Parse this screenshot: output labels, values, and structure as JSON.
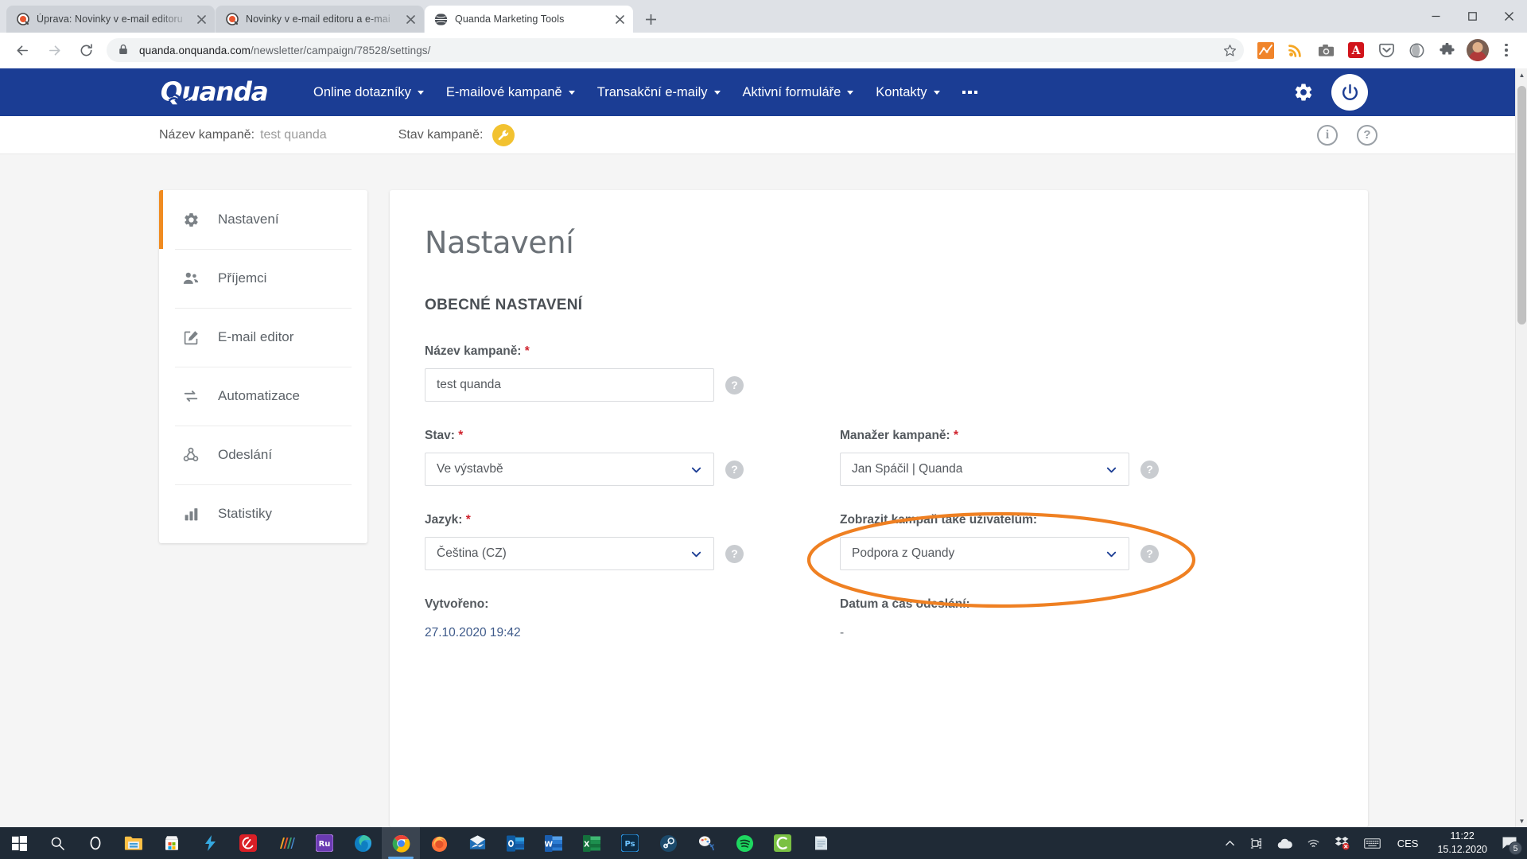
{
  "browser": {
    "tabs": [
      {
        "title": "Úprava: Novinky v e-mail editoru",
        "favicon": "quanda-favicon",
        "active": false
      },
      {
        "title": "Novinky v e-mail editoru a e-mai",
        "favicon": "quanda-favicon",
        "active": false
      },
      {
        "title": "Quanda Marketing Tools",
        "favicon": "globe-favicon",
        "active": true
      }
    ],
    "new_tab_label": "+",
    "window_controls": {
      "minimize": "–",
      "maximize": "□",
      "close": "✕"
    },
    "nav": {
      "back": "←",
      "forward": "→",
      "reload": "⟳"
    },
    "omnibox": {
      "url_host": "quanda.onquanda.com",
      "url_path": "/newsletter/campaign/78528/settings/",
      "lock_icon": "lock-icon",
      "star_icon": "bookmark-star-icon"
    },
    "extensions": [
      "analytics-chart-icon",
      "rss-feed-icon",
      "screenshot-camera-icon",
      "adobe-acrobat-icon",
      "pocket-save-icon",
      "circle-extension-icon",
      "extensions-puzzle-icon"
    ],
    "profile_avatar": "user-avatar",
    "menu_icon": "chrome-menu-kebab-icon"
  },
  "appbar": {
    "brand": "Quanda",
    "nav_items": [
      {
        "label": "Online dotazníky",
        "has_caret": true
      },
      {
        "label": "E-mailové kampaně",
        "has_caret": true
      },
      {
        "label": "Transakční e-maily",
        "has_caret": true
      },
      {
        "label": "Aktivní formuláře",
        "has_caret": true
      },
      {
        "label": "Kontakty",
        "has_caret": true
      }
    ],
    "overflow": "more-menu-dots",
    "settings_icon": "gear-icon",
    "logout_icon": "power-icon",
    "bg_color": "#1b3d94"
  },
  "infostrip": {
    "campaign_name_label": "Název kampaně:",
    "campaign_name_value": "test quanda",
    "campaign_status_label": "Stav kampaně:",
    "campaign_status_icon": "wrench-icon",
    "status_color": "#f2c230",
    "info_icon": "info-circle-icon",
    "help_icon": "question-circle-icon"
  },
  "sidebar": {
    "items": [
      {
        "label": "Nastavení",
        "icon": "gear-icon",
        "active": true
      },
      {
        "label": "Příjemci",
        "icon": "people-icon",
        "active": false
      },
      {
        "label": "E-mail editor",
        "icon": "edit-square-icon",
        "active": false
      },
      {
        "label": "Automatizace",
        "icon": "loop-arrows-icon",
        "active": false
      },
      {
        "label": "Odeslání",
        "icon": "share-nodes-icon",
        "active": false
      },
      {
        "label": "Statistiky",
        "icon": "bar-chart-icon",
        "active": false
      }
    ],
    "active_accent": "#f08b20"
  },
  "main": {
    "title": "Nastavení",
    "section_title": "OBECNÉ NASTAVENÍ",
    "fields": {
      "campaign_name": {
        "label": "Název kampaně:",
        "required": "*",
        "value": "test quanda",
        "help": "?"
      },
      "state": {
        "label": "Stav:",
        "required": "*",
        "value": "Ve výstavbě",
        "help": "?"
      },
      "manager": {
        "label": "Manažer kampaně:",
        "required": "*",
        "value": "Jan Spáčil | Quanda",
        "help": "?"
      },
      "language": {
        "label": "Jazyk:",
        "required": "*",
        "value": "Čeština (CZ)",
        "help": "?"
      },
      "show_to_users": {
        "label": "Zobrazit kampaň také uživatelům:",
        "required": "",
        "value": "Podpora z Quandy",
        "help": "?"
      },
      "created": {
        "label": "Vytvořeno:",
        "value": "27.10.2020 19:42"
      },
      "send_datetime": {
        "label": "Datum a čas odeslání:",
        "value": "-"
      }
    },
    "annotation": {
      "shape": "ellipse",
      "color": "#ef8022"
    }
  },
  "taskbar": {
    "apps": [
      "windows-start-icon",
      "search-icon",
      "cortana-icon",
      "file-explorer-icon",
      "microsoft-store-icon",
      "lightning-app-icon",
      "adobe-creative-cloud-icon",
      "colorful-bars-app-icon",
      "adobe-premiere-rush-icon",
      "microsoft-edge-icon",
      "google-chrome-icon",
      "firefox-icon",
      "mail-app-icon",
      "microsoft-outlook-icon",
      "microsoft-word-icon",
      "microsoft-excel-icon",
      "adobe-photoshop-icon",
      "steam-icon",
      "paint-net-icon",
      "spotify-icon",
      "calendar-app-icon",
      "notes-app-icon"
    ],
    "tray": {
      "show_hidden_icon": "chevron-up-icon",
      "icons": [
        "camera-record-icon",
        "onedrive-cloud-icon",
        "wifi-icon",
        "dropbox-error-icon",
        "keyboard-layout-icon"
      ],
      "language": "CES",
      "time": "11:22",
      "date": "15.12.2020",
      "action_center_icon": "action-center-icon",
      "notification_count": "5"
    }
  }
}
